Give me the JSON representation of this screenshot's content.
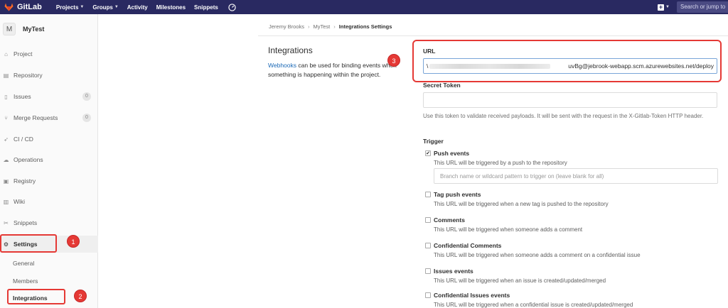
{
  "colors": {
    "navbar": "#292961",
    "link": "#1b69b6",
    "highlight": "#e53935"
  },
  "navbar": {
    "brand": "GitLab",
    "links": [
      {
        "label": "Projects",
        "dropdown": true
      },
      {
        "label": "Groups",
        "dropdown": true
      },
      {
        "label": "Activity",
        "dropdown": false
      },
      {
        "label": "Milestones",
        "dropdown": false
      },
      {
        "label": "Snippets",
        "dropdown": false
      }
    ],
    "search_placeholder": "Search or jump to"
  },
  "sidebar": {
    "avatar_letter": "M",
    "project_name": "MyTest",
    "items": [
      {
        "label": "Project",
        "icon": "home-icon"
      },
      {
        "label": "Repository",
        "icon": "doc-icon"
      },
      {
        "label": "Issues",
        "icon": "issues-icon",
        "count": "0"
      },
      {
        "label": "Merge Requests",
        "icon": "merge-icon",
        "count": "0"
      },
      {
        "label": "CI / CD",
        "icon": "rocket-icon"
      },
      {
        "label": "Operations",
        "icon": "cloud-icon"
      },
      {
        "label": "Registry",
        "icon": "box-icon"
      },
      {
        "label": "Wiki",
        "icon": "book-icon"
      },
      {
        "label": "Snippets",
        "icon": "scissors-icon"
      }
    ],
    "settings_label": "Settings",
    "sub_items": [
      "General",
      "Members",
      "Integrations"
    ]
  },
  "annotations": {
    "one": "1",
    "two": "2",
    "three": "3"
  },
  "breadcrumb": [
    "Jeremy Brooks",
    "MyTest",
    "Integrations Settings"
  ],
  "main": {
    "title": "Integrations",
    "desc_link": "Webhooks",
    "desc_rest": " can be used for binding events when something is happening within the project.",
    "url_label": "URL",
    "url_value": "\\uvBg@jebrook-webapp.scm.azurewebsites.net/deploy",
    "url_prefix": "\\",
    "secret_label": "Secret Token",
    "secret_help": "Use this token to validate received payloads. It will be sent with the request in the X-Gitlab-Token HTTP header.",
    "trigger_label": "Trigger",
    "triggers": [
      {
        "name": "Push events",
        "desc": "This URL will be triggered by a push to the repository",
        "checked": true
      },
      {
        "name": "Tag push events",
        "desc": "This URL will be triggered when a new tag is pushed to the repository",
        "checked": false
      },
      {
        "name": "Comments",
        "desc": "This URL will be triggered when someone adds a comment",
        "checked": false
      },
      {
        "name": "Confidential Comments",
        "desc": "This URL will be triggered when someone adds a comment on a confidential issue",
        "checked": false
      },
      {
        "name": "Issues events",
        "desc": "This URL will be triggered when an issue is created/updated/merged",
        "checked": false
      },
      {
        "name": "Confidential Issues events",
        "desc": "This URL will be triggered when a confidential issue is created/updated/merged",
        "checked": false
      }
    ],
    "branch_placeholder": "Branch name or wildcard pattern to trigger on (leave blank for all)"
  }
}
